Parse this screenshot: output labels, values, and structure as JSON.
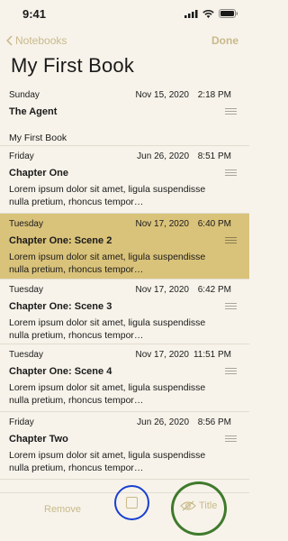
{
  "status": {
    "time": "9:41"
  },
  "nav": {
    "back_label": "Notebooks",
    "done_label": "Done"
  },
  "page": {
    "title": "My First Book"
  },
  "rows": [
    {
      "day": "Sunday",
      "date": "Nov 15, 2020",
      "time": "2:18 PM",
      "title": "The Agent",
      "body": "My First Book",
      "selected": false
    },
    {
      "day": "Friday",
      "date": "Jun 26, 2020",
      "time": "8:51 PM",
      "title": "Chapter One",
      "body": "Lorem ipsum dolor sit amet, ligula suspendisse nulla pretium, rhoncus tempor…",
      "selected": false
    },
    {
      "day": "Tuesday",
      "date": "Nov 17, 2020",
      "time": "6:40 PM",
      "title": "Chapter One: Scene 2",
      "body": "Lorem ipsum dolor sit amet, ligula suspendisse nulla pretium, rhoncus tempor…",
      "selected": true
    },
    {
      "day": "Tuesday",
      "date": "Nov 17, 2020",
      "time": "6:42 PM",
      "title": "Chapter One: Scene 3",
      "body": "Lorem ipsum dolor sit amet, ligula suspendisse nulla pretium, rhoncus tempor…",
      "selected": false
    },
    {
      "day": "Tuesday",
      "date": "Nov 17, 2020",
      "time": "11:51 PM",
      "title": "Chapter One: Scene 4",
      "body": "Lorem ipsum dolor sit amet, ligula suspendisse nulla pretium, rhoncus tempor…",
      "selected": false
    },
    {
      "day": "Friday",
      "date": "Jun 26, 2020",
      "time": "8:56 PM",
      "title": "Chapter Two",
      "body": "Lorem ipsum dolor sit amet, ligula suspendisse nulla pretium, rhoncus tempor…",
      "selected": false
    }
  ],
  "toolbar": {
    "remove_label": "Remove",
    "title_label": "Title"
  },
  "colors": {
    "accent": "#c9b98a",
    "selected_row": "#d9c27a",
    "annotation_blue": "#1a3fd1",
    "annotation_green": "#3f7a2c"
  },
  "icons": {
    "back": "chevron-left-icon",
    "grip": "drag-handle-icon",
    "title": "eye-slash-icon",
    "select": "checkbox-icon"
  }
}
